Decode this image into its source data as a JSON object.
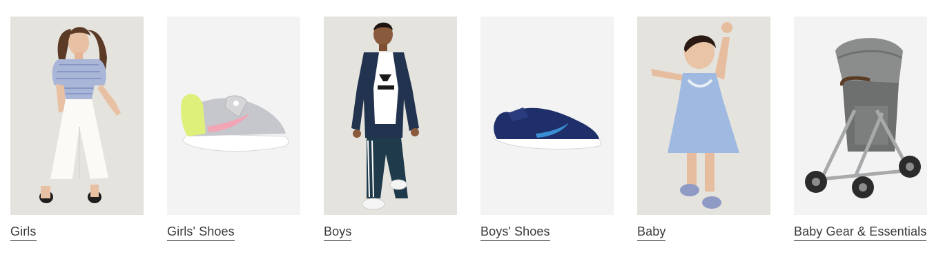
{
  "categories": [
    {
      "label": "Girls",
      "image": "girl-in-striped-top-photo",
      "bg": "#e5e3de"
    },
    {
      "label": "Girls' Shoes",
      "image": "girls-sneaker-photo",
      "bg": "#f3f3f3"
    },
    {
      "label": "Boys",
      "image": "boy-in-track-suit-photo",
      "bg": "#e5e3de"
    },
    {
      "label": "Boys' Shoes",
      "image": "boys-navy-sneaker-photo",
      "bg": "#f3f3f3"
    },
    {
      "label": "Baby",
      "image": "baby-in-blue-dress-photo",
      "bg": "#e5e3de"
    },
    {
      "label": "Baby Gear & Essentials",
      "image": "stroller-photo",
      "bg": "#f3f3f3"
    }
  ],
  "colors": {
    "text": "#393939",
    "warm_bg": "#e5e3de",
    "cool_bg": "#f3f3f3"
  }
}
